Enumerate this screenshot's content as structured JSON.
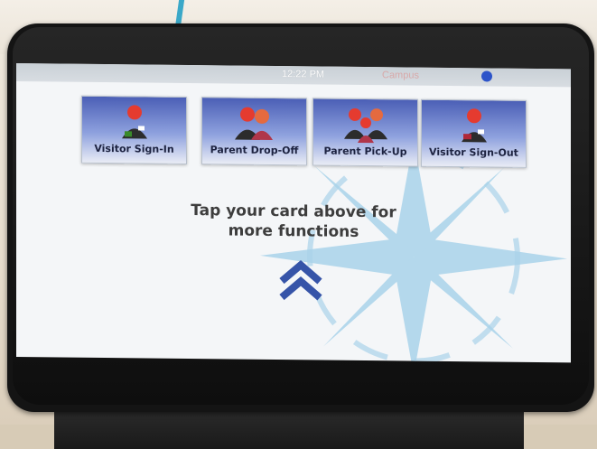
{
  "status_bar": {
    "time": "12:22 PM",
    "right_text": "Campus",
    "account_icon": "person-icon"
  },
  "tiles": [
    {
      "label": "Visitor Sign-In",
      "icon": "visitor-sign-in-icon"
    },
    {
      "label": "Parent Drop-Off",
      "icon": "parent-drop-off-icon"
    },
    {
      "label": "Parent Pick-Up",
      "icon": "parent-pick-up-icon"
    },
    {
      "label": "Visitor Sign-Out",
      "icon": "visitor-sign-out-icon"
    }
  ],
  "message": {
    "line1": "Tap your card above for",
    "line2": "more functions"
  },
  "colors": {
    "tile_top": "#4b5fb6",
    "chevron": "#3654a8",
    "compass": "#a9d3ea"
  }
}
